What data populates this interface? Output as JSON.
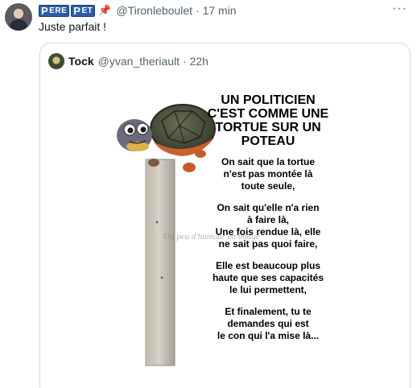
{
  "tweet": {
    "name_words": [
      {
        "cap": "P",
        "rest": "ERE"
      },
      {
        "cap": "P",
        "rest": "ET"
      }
    ],
    "pin_icon": "pushpin-icon",
    "handle": "@Tironleboulet",
    "time": "· 17 min",
    "more": "···",
    "text": "Juste parfait !"
  },
  "quote": {
    "name": "Tock",
    "handle": "@yvan_theriault",
    "time": "· 22h",
    "meme": {
      "title_lines": [
        "UN POLITICIEN",
        "C'EST COMME UNE",
        "TORTUE SUR UN",
        "POTEAU"
      ],
      "paragraphs": [
        [
          "On sait que la tortue",
          "n'est pas montée là",
          "toute seule,"
        ],
        [
          "On sait qu'elle n'a rien",
          "à faire là,",
          "Une fois rendue là, elle",
          "ne sait pas quoi faire,"
        ],
        [
          "Elle est beaucoup plus",
          "haute que ses capacités",
          "le lui permettent,"
        ],
        [
          "Et finalement, tu te",
          "demandes qui est",
          "le con qui l'a mise là..."
        ]
      ],
      "watermark": "Un peu d'humour en image"
    }
  }
}
